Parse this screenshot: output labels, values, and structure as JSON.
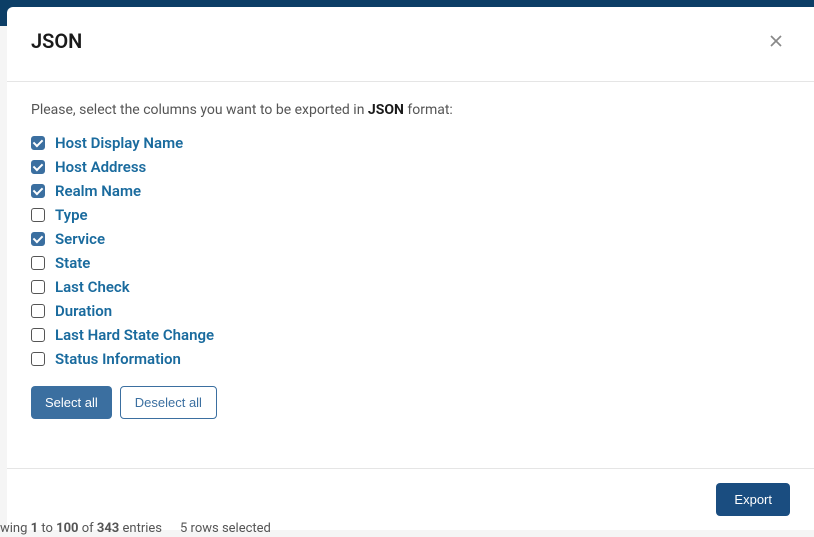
{
  "modal": {
    "title": "JSON",
    "instruction_prefix": "Please, select the columns you want to be exported in ",
    "instruction_format": "JSON",
    "instruction_suffix": " format:",
    "columns": [
      {
        "label": "Host Display Name",
        "checked": true
      },
      {
        "label": "Host Address",
        "checked": true
      },
      {
        "label": "Realm Name",
        "checked": true
      },
      {
        "label": "Type",
        "checked": false
      },
      {
        "label": "Service",
        "checked": true
      },
      {
        "label": "State",
        "checked": false
      },
      {
        "label": "Last Check",
        "checked": false
      },
      {
        "label": "Duration",
        "checked": false
      },
      {
        "label": "Last Hard State Change",
        "checked": false
      },
      {
        "label": "Status Information",
        "checked": false
      }
    ],
    "select_all_label": "Select all",
    "deselect_all_label": "Deselect all",
    "export_label": "Export"
  },
  "footer": {
    "showing_prefix": "wing ",
    "from": "1",
    "to_word": " to ",
    "to": "100",
    "of_word": " of ",
    "total": "343",
    "entries_word": " entries",
    "selected": "5 rows selected"
  }
}
